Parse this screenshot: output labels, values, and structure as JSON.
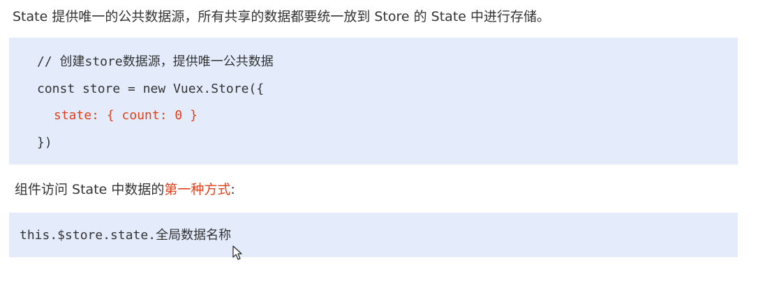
{
  "intro_text": "State 提供唯一的公共数据源，所有共享的数据都要统一放到 Store 的 State 中进行存储。",
  "code_block_1": {
    "lines": [
      "// 创建store数据源，提供唯一公共数据",
      "const store = new Vuex.Store({",
      "state: { count: 0 }",
      "})"
    ],
    "accent_color": "#e0401c",
    "background_color": "#e4ecfc"
  },
  "paragraph_2": {
    "prefix": "组件访问 State 中数据的",
    "highlight": "第一种方式",
    "suffix": ":"
  },
  "code_block_2": {
    "line": "this.$store.state.全局数据名称"
  },
  "icons": {
    "cursor": "mouse-pointer-icon"
  }
}
